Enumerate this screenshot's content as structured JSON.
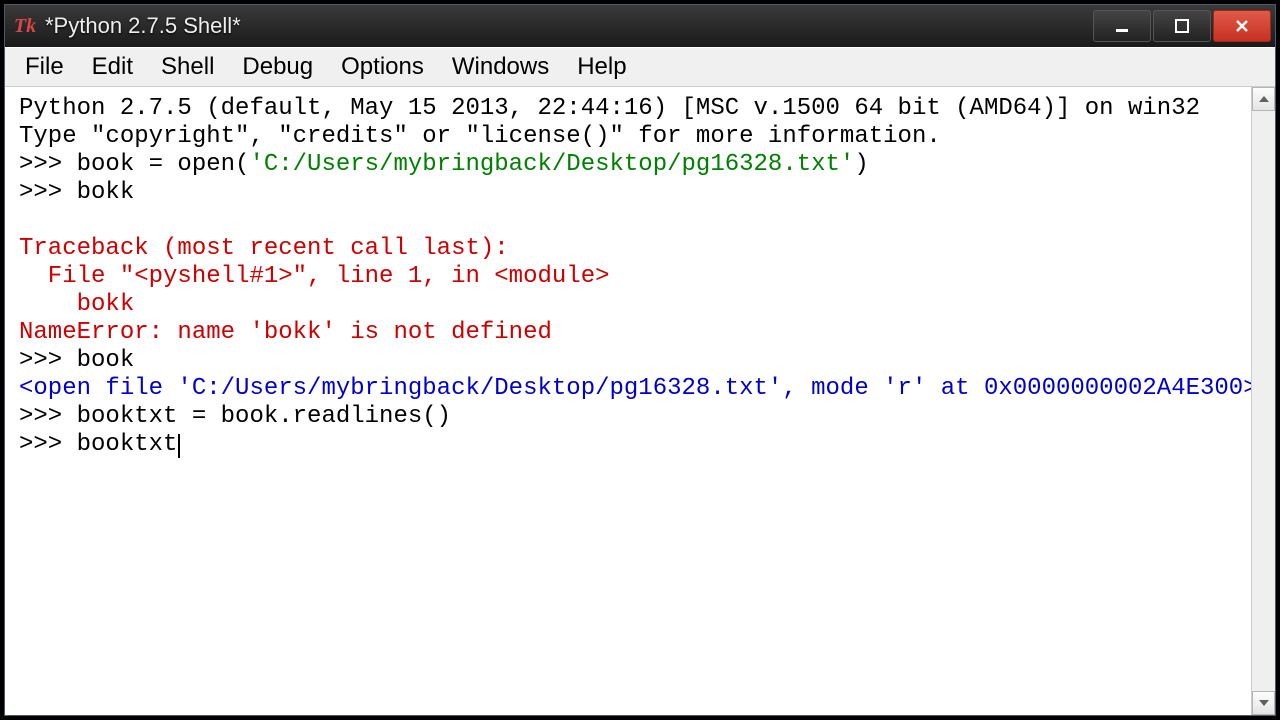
{
  "window": {
    "title": "*Python 2.7.5 Shell*"
  },
  "menu": {
    "file": "File",
    "edit": "Edit",
    "shell": "Shell",
    "debug": "Debug",
    "options": "Options",
    "windows": "Windows",
    "help": "Help"
  },
  "shell": {
    "banner_line1": "Python 2.7.5 (default, May 15 2013, 22:44:16) [MSC v.1500 64 bit (AMD64)] on win32",
    "banner_line2": "Type \"copyright\", \"credits\" or \"license()\" for more information.",
    "prompt": ">>> ",
    "line1_pre": "book = open(",
    "line1_str": "'C:/Users/mybringback/Desktop/pg16328.txt'",
    "line1_post": ")",
    "line2": "bokk",
    "blank": "",
    "err1": "Traceback (most recent call last):",
    "err2": "  File \"<pyshell#1>\", line 1, in <module>",
    "err3": "    bokk",
    "err4": "NameError: name 'bokk' is not defined",
    "line3": "book",
    "out1": "<open file 'C:/Users/mybringback/Desktop/pg16328.txt', mode 'r' at 0x0000000002A4E300>",
    "line4": "booktxt = book.readlines()",
    "line5": "booktxt"
  }
}
